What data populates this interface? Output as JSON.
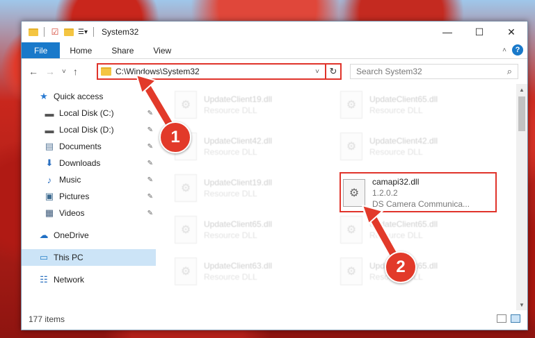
{
  "window": {
    "title": "System32",
    "controls": {
      "minimize": "—",
      "maximize": "☐",
      "close": "✕"
    }
  },
  "ribbon": {
    "tabs": [
      "File",
      "Home",
      "Share",
      "View"
    ],
    "help_label": "?"
  },
  "nav": {
    "back": "←",
    "forward": "→",
    "recent": "˅",
    "up": "↑"
  },
  "address": {
    "path": "C:\\Windows\\System32",
    "chevron": "˅",
    "refresh": "↻"
  },
  "search": {
    "placeholder": "Search System32",
    "icon": "⌕"
  },
  "sidebar": {
    "items": [
      {
        "label": "Quick access",
        "icon": "star-icon",
        "glyph": "★",
        "pinned": false
      },
      {
        "label": "Local Disk (C:)",
        "icon": "drive-icon",
        "glyph": "▬",
        "pinned": true
      },
      {
        "label": "Local Disk (D:)",
        "icon": "drive-icon",
        "glyph": "▬",
        "pinned": true
      },
      {
        "label": "Documents",
        "icon": "document-icon",
        "glyph": "▤",
        "pinned": true
      },
      {
        "label": "Downloads",
        "icon": "download-icon",
        "glyph": "⬇",
        "pinned": true
      },
      {
        "label": "Music",
        "icon": "music-icon",
        "glyph": "♪",
        "pinned": true
      },
      {
        "label": "Pictures",
        "icon": "pictures-icon",
        "glyph": "▣",
        "pinned": true
      },
      {
        "label": "Videos",
        "icon": "video-icon",
        "glyph": "▦",
        "pinned": true
      },
      {
        "label": "OneDrive",
        "icon": "cloud-icon",
        "glyph": "☁",
        "pinned": false
      },
      {
        "label": "This PC",
        "icon": "computer-icon",
        "glyph": "▭",
        "pinned": false,
        "selected": true
      },
      {
        "label": "Network",
        "icon": "network-icon",
        "glyph": "☷",
        "pinned": false
      }
    ],
    "pin_glyph": "📌"
  },
  "files": [
    {
      "name": "UpdateClient19.dll",
      "type": "Resource DLL"
    },
    {
      "name": "UpdateClient65.dll",
      "type": "Resource DLL"
    },
    {
      "name": "UpdateClient42.dll",
      "type": "Resource DLL"
    },
    {
      "name": "UpdateClient42.dll",
      "type": "Resource DLL"
    },
    {
      "name": "UpdateClient19.dll",
      "type": "Resource DLL"
    },
    {
      "name": "UpdateClient65.dll",
      "type": "Resource DLL"
    },
    {
      "name": "UpdateClient65.dll",
      "type": "Resource DLL"
    },
    {
      "name": "UpdateClient63.dll",
      "type": "Resource DLL"
    },
    {
      "name": "UpdateClient65.dll",
      "type": "Resource DLL"
    }
  ],
  "highlighted_file": {
    "name": "camapi32.dll",
    "version": "1.2.0.2",
    "description": "DS Camera Communica..."
  },
  "status": {
    "item_count": "177 items"
  },
  "annotations": {
    "step1": "1",
    "step2": "2",
    "arrow_color": "#e23a2a"
  }
}
